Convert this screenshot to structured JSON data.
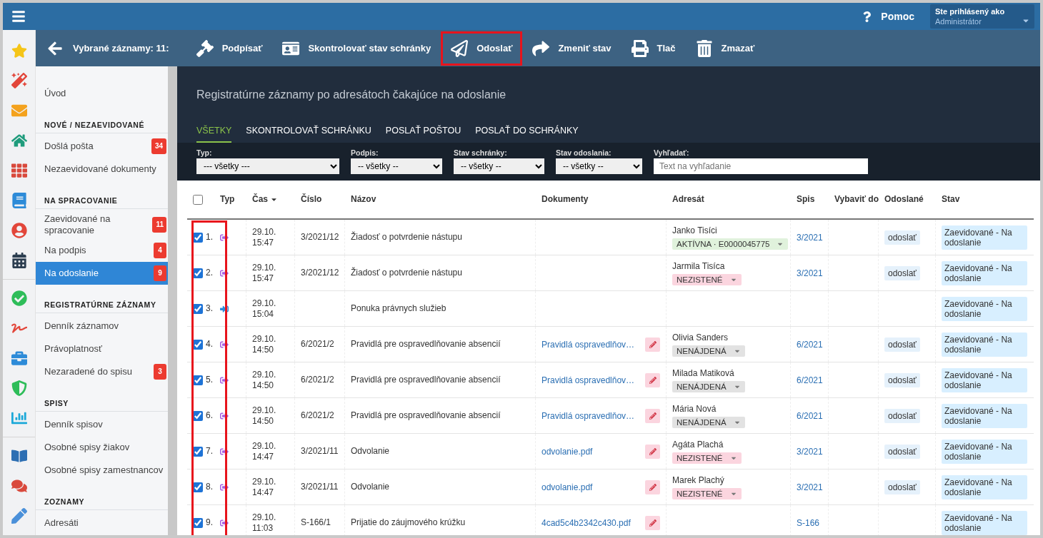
{
  "topbar": {
    "help": "Pomoc",
    "user_label": "Ste prihlásený ako",
    "user_name": "Administrátor"
  },
  "toolbar": {
    "selected_label": "Vybrané záznamy: 11:",
    "actions": [
      {
        "kind": "sign",
        "label": "Podpísať",
        "highlighted": false
      },
      {
        "kind": "check",
        "label": "Skontrolovať stav schránky",
        "highlighted": false
      },
      {
        "kind": "send",
        "label": "Odoslať",
        "highlighted": true
      },
      {
        "kind": "status",
        "label": "Zmeniť stav",
        "highlighted": false
      },
      {
        "kind": "print",
        "label": "Tlač",
        "highlighted": false
      },
      {
        "kind": "delete",
        "label": "Zmazať",
        "highlighted": false
      }
    ]
  },
  "sidebar": {
    "top_item": {
      "label": "Úvod",
      "selected": false
    },
    "sections": [
      {
        "title": "NOVÉ / NEZAEVIDOVANÉ",
        "items": [
          {
            "label": "Došlá pošta",
            "count": "34",
            "selected": false
          },
          {
            "label": "Nezaevidované dokumenty",
            "selected": false
          }
        ]
      },
      {
        "title": "NA SPRACOVANIE",
        "items": [
          {
            "label": "Zaevidované na spracovanie",
            "count": "11",
            "selected": false
          },
          {
            "label": "Na podpis",
            "count": "4",
            "selected": false
          },
          {
            "label": "Na odoslanie",
            "count": "9",
            "selected": true
          }
        ]
      },
      {
        "title": "REGISTRATÚRNE ZÁZNAMY",
        "items": [
          {
            "label": "Denník záznamov",
            "selected": false
          },
          {
            "label": "Právoplatnosť",
            "selected": false
          },
          {
            "label": "Nezaradené do spisu",
            "count": "3",
            "selected": false
          }
        ]
      },
      {
        "title": "SPISY",
        "items": [
          {
            "label": "Denník spisov",
            "selected": false
          },
          {
            "label": "Osobné spisy žiakov",
            "selected": false
          },
          {
            "label": "Osobné spisy zamestnancov",
            "selected": false
          }
        ]
      },
      {
        "title": "ZOZNAMY",
        "items": [
          {
            "label": "Adresáti",
            "selected": false
          }
        ]
      }
    ]
  },
  "header": {
    "subtitle": "Registratúrne záznamy po adresátoch čakajúce na odoslanie"
  },
  "tabs": [
    {
      "label": "VŠETKY",
      "selected": true
    },
    {
      "label": "SKONTROLOVAŤ SCHRÁNKU",
      "selected": false
    },
    {
      "label": "POSLAŤ POŠTOU",
      "selected": false
    },
    {
      "label": "POSLAŤ DO SCHRÁNKY",
      "selected": false
    }
  ],
  "filters": [
    {
      "kind": "select",
      "label": "Typ:",
      "value": "--- všetky ---"
    },
    {
      "kind": "select",
      "label": "Podpis:",
      "value": "-- všetky --"
    },
    {
      "kind": "select",
      "label": "Stav schránky:",
      "value": "-- všetky --"
    },
    {
      "kind": "select",
      "label": "Stav odoslania:",
      "value": "-- všetky --"
    },
    {
      "kind": "search",
      "label": "Vyhľadať:",
      "placeholder": "Text na vyhľadanie"
    }
  ],
  "table": {
    "select_all_checked": false,
    "selection_highlighted": true,
    "columns": [
      "Typ",
      "Čas",
      "Číslo",
      "Názov",
      "Dokumenty",
      "Adresát",
      "Spis",
      "Vybaviť do",
      "Odoslané",
      "Stav"
    ],
    "rows": [
      {
        "checked": true,
        "index": "1.",
        "kind": "outgoing",
        "date": "29.10.",
        "time": "15:47",
        "number": "3/2021/12",
        "name": "Žiadosť o potvrdenie nástupu",
        "addressee": {
          "name": "Janko Tisíci",
          "status": {
            "kind": "active",
            "label": "AKTÍVNA · E0000045775"
          }
        },
        "file": "3/2021",
        "sent": "odoslať",
        "state": "Zaevidované - Na odoslanie"
      },
      {
        "checked": true,
        "index": "2.",
        "kind": "outgoing",
        "date": "29.10.",
        "time": "15:47",
        "number": "3/2021/12",
        "name": "Žiadosť o potvrdenie nástupu",
        "addressee": {
          "name": "Jarmila Tisíca",
          "status": {
            "kind": "unknown",
            "label": "NEZISTENÉ"
          }
        },
        "file": "3/2021",
        "sent": "odoslať",
        "state": "Zaevidované - Na odoslanie"
      },
      {
        "checked": true,
        "index": "3.",
        "kind": "incoming",
        "date": "29.10.",
        "time": "15:04",
        "name": "Ponuka právnych služieb",
        "state": "Zaevidované - Na odoslanie"
      },
      {
        "checked": true,
        "index": "4.",
        "kind": "outgoing",
        "date": "29.10.",
        "time": "14:50",
        "number": "6/2021/2",
        "name": "Pravidlá pre ospravedlňovanie absencií",
        "document": "Pravidlá ospravedlňov…",
        "addressee": {
          "name": "Olivia Sanders",
          "status": {
            "kind": "not_found",
            "label": "NENÁJDENÁ"
          }
        },
        "file": "6/2021",
        "sent": "odoslať",
        "state": "Zaevidované - Na odoslanie"
      },
      {
        "checked": true,
        "index": "5.",
        "kind": "outgoing",
        "date": "29.10.",
        "time": "14:50",
        "number": "6/2021/2",
        "name": "Pravidlá pre ospravedlňovanie absencií",
        "document": "Pravidlá ospravedlňov…",
        "addressee": {
          "name": "Milada Matiková",
          "status": {
            "kind": "not_found",
            "label": "NENÁJDENÁ"
          }
        },
        "file": "6/2021",
        "sent": "odoslať",
        "state": "Zaevidované - Na odoslanie"
      },
      {
        "checked": true,
        "index": "6.",
        "kind": "outgoing",
        "date": "29.10.",
        "time": "14:50",
        "number": "6/2021/2",
        "name": "Pravidlá pre ospravedlňovanie absencií",
        "document": "Pravidlá ospravedlňov…",
        "addressee": {
          "name": "Mária Nová",
          "status": {
            "kind": "not_found",
            "label": "NENÁJDENÁ"
          }
        },
        "file": "6/2021",
        "sent": "odoslať",
        "state": "Zaevidované - Na odoslanie"
      },
      {
        "checked": true,
        "index": "7.",
        "kind": "outgoing",
        "date": "29.10.",
        "time": "14:47",
        "number": "3/2021/11",
        "name": "Odvolanie",
        "document": "odvolanie.pdf",
        "addressee": {
          "name": "Agáta Plachá",
          "status": {
            "kind": "unknown",
            "label": "NEZISTENÉ"
          }
        },
        "file": "3/2021",
        "sent": "odoslať",
        "state": "Zaevidované - Na odoslanie"
      },
      {
        "checked": true,
        "index": "8.",
        "kind": "outgoing",
        "date": "29.10.",
        "time": "14:47",
        "number": "3/2021/11",
        "name": "Odvolanie",
        "document": "odvolanie.pdf",
        "addressee": {
          "name": "Marek Plachý",
          "status": {
            "kind": "unknown",
            "label": "NEZISTENÉ"
          }
        },
        "file": "3/2021",
        "sent": "odoslať",
        "state": "Zaevidované - Na odoslanie"
      },
      {
        "checked": true,
        "index": "9.",
        "kind": "outgoing",
        "date": "29.10.",
        "time": "11:03",
        "number": "S-166/1",
        "name": "Prijatie do záujmového krúžku",
        "document": "4cad5c4b2342c430.pdf",
        "file": "S-166",
        "state": "Zaevidované - Na odoslanie"
      }
    ]
  }
}
